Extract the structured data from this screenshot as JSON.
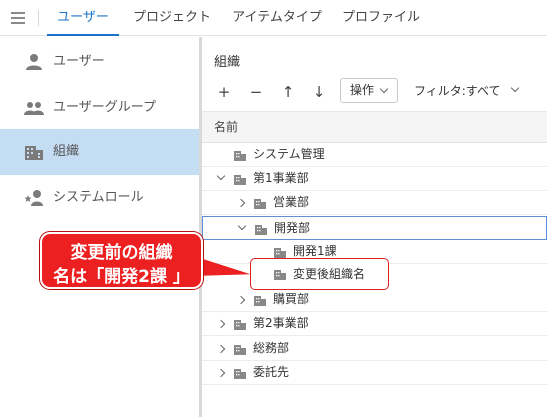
{
  "tabs": [
    {
      "label": "ユーザー",
      "active": true
    },
    {
      "label": "プロジェクト",
      "active": false
    },
    {
      "label": "アイテムタイプ",
      "active": false
    },
    {
      "label": "プロファイル",
      "active": false
    }
  ],
  "sidebar": {
    "items": [
      {
        "label": "ユーザー",
        "icon": "person-icon"
      },
      {
        "label": "ユーザーグループ",
        "icon": "group-icon"
      },
      {
        "label": "組織",
        "icon": "building-icon",
        "active": true
      },
      {
        "label": "システムロール",
        "icon": "person-star-icon"
      }
    ]
  },
  "main": {
    "title": "組織",
    "toolbar": {
      "add": "+",
      "remove": "−",
      "up": "↑",
      "down": "↓",
      "operations_label": "操作",
      "filter_label": "フィルタ:すべて"
    },
    "column_header": "名前",
    "tree": [
      {
        "label": "システム管理",
        "level": 0,
        "expander": "none"
      },
      {
        "label": "第1事業部",
        "level": 0,
        "expander": "expanded"
      },
      {
        "label": "営業部",
        "level": 1,
        "expander": "collapsed"
      },
      {
        "label": "開発部",
        "level": 1,
        "expander": "expanded",
        "selected": true
      },
      {
        "label": "開発1課",
        "level": 2,
        "expander": "none"
      },
      {
        "label": "変更後組織名",
        "level": 2,
        "expander": "none",
        "highlighted": true
      },
      {
        "label": "購買部",
        "level": 1,
        "expander": "collapsed"
      },
      {
        "label": "第2事業部",
        "level": 0,
        "expander": "collapsed"
      },
      {
        "label": "総務部",
        "level": 0,
        "expander": "collapsed"
      },
      {
        "label": "委託先",
        "level": 0,
        "expander": "collapsed"
      }
    ]
  },
  "callout": {
    "line1": "変更前の組織",
    "line2": "名は「開発2課 」"
  },
  "colors": {
    "accent": "#1a73c9",
    "sidebar_active": "#c4ddf3",
    "callout": "#ec2020"
  }
}
